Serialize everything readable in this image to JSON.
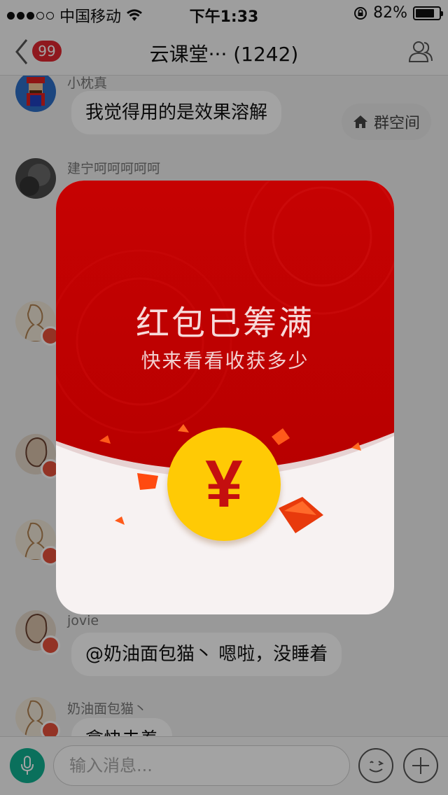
{
  "status_bar": {
    "carrier": "中国移动",
    "time": "下午1:33",
    "battery": "82%",
    "battery_level": 0.82
  },
  "nav": {
    "badge": "99",
    "title": "云课堂··· (1242)"
  },
  "chat": {
    "group_space_label": "群空间",
    "messages": [
      {
        "sender": "小枕真",
        "text": "我觉得用的是效果溶解"
      },
      {
        "sender": "建宁呵呵呵呵呵",
        "text": ""
      },
      {
        "sender": "jovie",
        "text": "@奶油面包猫丶 嗯啦，没睡着"
      },
      {
        "sender": "奶油面包猫丶",
        "text": "拿快去着"
      }
    ]
  },
  "input": {
    "placeholder": "输入消息..."
  },
  "red_packet": {
    "title": "红包已筹满",
    "subtitle": "快来看看收获多少",
    "coin_symbol": "¥"
  },
  "colors": {
    "packet_red": "#c40000",
    "coin": "#ffca05",
    "badge": "#e0262f",
    "mic": "#10b090"
  },
  "icons": [
    "back-chevron-icon",
    "members-icon",
    "home-icon",
    "wifi-icon",
    "rotation-lock-icon",
    "battery-icon",
    "mic-icon",
    "emoji-icon",
    "plus-icon"
  ]
}
